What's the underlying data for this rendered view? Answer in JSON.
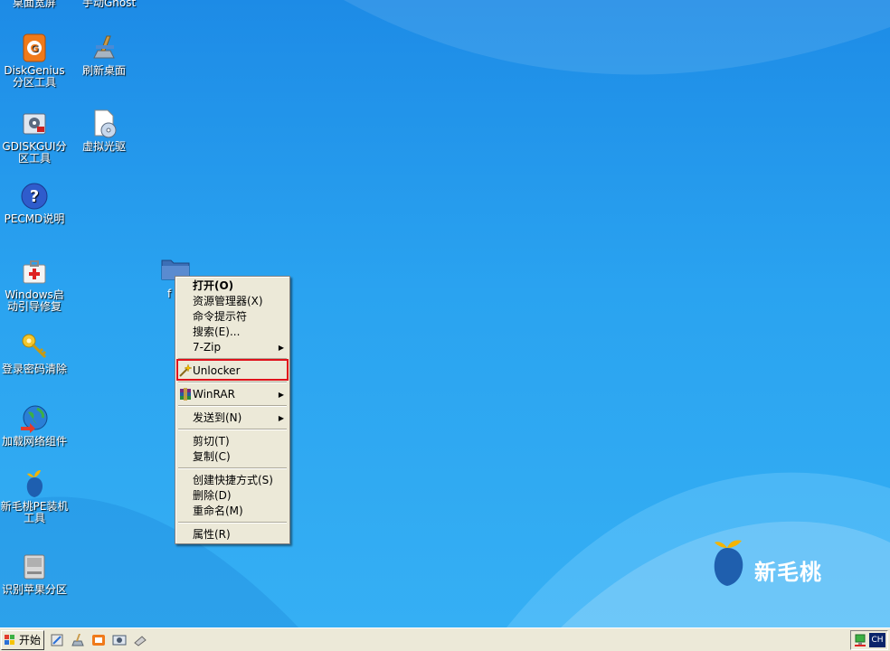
{
  "desktop": {
    "cut_labels": [
      "桌面宽屏",
      "手动Ghost"
    ],
    "icons": [
      {
        "label": "DiskGenius分区工具",
        "icon": "diskgenius-icon"
      },
      {
        "label": "刷新桌面",
        "icon": "refresh-desktop-icon"
      },
      {
        "label": "GDISKGUI分区工具",
        "icon": "gdiskgui-icon"
      },
      {
        "label": "虚拟光驱",
        "icon": "virtual-drive-icon"
      },
      {
        "label": "PECMD说明",
        "icon": "help-icon"
      },
      {
        "label": "Windows启动引导修复",
        "icon": "boot-repair-icon"
      },
      {
        "label": "登录密码清除",
        "icon": "key-icon"
      },
      {
        "label": "加载网络组件",
        "icon": "network-globe-icon"
      },
      {
        "label": "新毛桃PE装机工具",
        "icon": "peach-icon"
      },
      {
        "label": "识别苹果分区",
        "icon": "drive-icon"
      }
    ],
    "folder_label": "f"
  },
  "context_menu": {
    "items": [
      {
        "label": "打开(O)",
        "bold": true
      },
      {
        "label": "资源管理器(X)"
      },
      {
        "label": "命令提示符"
      },
      {
        "label": "搜索(E)..."
      },
      {
        "label": "7-Zip",
        "submenu": true
      },
      {
        "label": "Unlocker",
        "icon": "unlocker-wand-icon"
      },
      {
        "label": "WinRAR",
        "icon": "winrar-icon",
        "submenu": true
      },
      {
        "label": "发送到(N)",
        "submenu": true
      },
      {
        "label": "剪切(T)"
      },
      {
        "label": "复制(C)"
      },
      {
        "label": "创建快捷方式(S)"
      },
      {
        "label": "删除(D)"
      },
      {
        "label": "重命名(M)"
      },
      {
        "label": "属性(R)"
      }
    ],
    "arrow": "▶",
    "highlight_color": "#e0101a"
  },
  "brand": {
    "text": "新毛桃"
  },
  "taskbar": {
    "start_label": "开始",
    "tray_ime": "CH"
  },
  "colors": {
    "wallpaper": "#2aa3f0",
    "menu_bg": "#ece9d8"
  }
}
